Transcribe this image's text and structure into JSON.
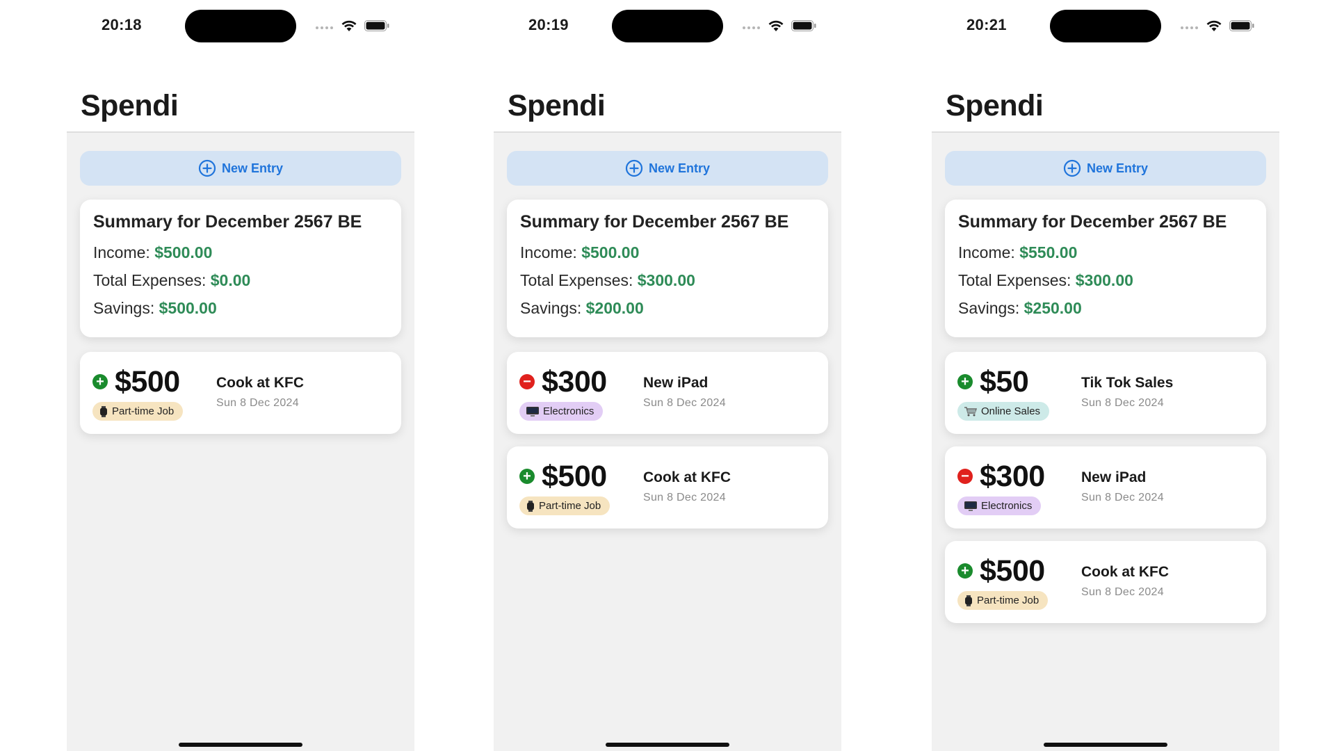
{
  "app": {
    "title": "Spendi",
    "new_entry_label": "New Entry",
    "accent_color": "#1f74db",
    "value_color": "#2e8b57"
  },
  "screens": [
    {
      "time": "20:18",
      "summary": {
        "title": "Summary for December 2567 BE",
        "income_label": "Income:",
        "income": "$500.00",
        "expenses_label": "Total Expenses:",
        "expenses": "$0.00",
        "savings_label": "Savings:",
        "savings": "$500.00"
      },
      "entries": [
        {
          "sign": "+",
          "type": "income",
          "amount": "$500",
          "name": "Cook at KFC",
          "date": "Sun 8 Dec 2024",
          "category": "Part-time Job",
          "category_icon": "smartwatch-icon"
        }
      ]
    },
    {
      "time": "20:19",
      "summary": {
        "title": "Summary for December 2567 BE",
        "income_label": "Income:",
        "income": "$500.00",
        "expenses_label": "Total Expenses:",
        "expenses": "$300.00",
        "savings_label": "Savings:",
        "savings": "$200.00"
      },
      "entries": [
        {
          "sign": "−",
          "type": "expense",
          "amount": "$300",
          "name": "New iPad",
          "date": "Sun 8 Dec 2024",
          "category": "Electronics",
          "category_icon": "monitor-icon"
        },
        {
          "sign": "+",
          "type": "income",
          "amount": "$500",
          "name": "Cook at KFC",
          "date": "Sun 8 Dec 2024",
          "category": "Part-time Job",
          "category_icon": "smartwatch-icon"
        }
      ]
    },
    {
      "time": "20:21",
      "summary": {
        "title": "Summary for December 2567 BE",
        "income_label": "Income:",
        "income": "$550.00",
        "expenses_label": "Total Expenses:",
        "expenses": "$300.00",
        "savings_label": "Savings:",
        "savings": "$250.00"
      },
      "entries": [
        {
          "sign": "+",
          "type": "income",
          "amount": "$50",
          "name": "Tik Tok Sales",
          "date": "Sun 8 Dec 2024",
          "category": "Online Sales",
          "category_icon": "shopping-cart-icon"
        },
        {
          "sign": "−",
          "type": "expense",
          "amount": "$300",
          "name": "New iPad",
          "date": "Sun 8 Dec 2024",
          "category": "Electronics",
          "category_icon": "monitor-icon"
        },
        {
          "sign": "+",
          "type": "income",
          "amount": "$500",
          "name": "Cook at KFC",
          "date": "Sun 8 Dec 2024",
          "category": "Part-time Job",
          "category_icon": "smartwatch-icon"
        }
      ]
    }
  ]
}
